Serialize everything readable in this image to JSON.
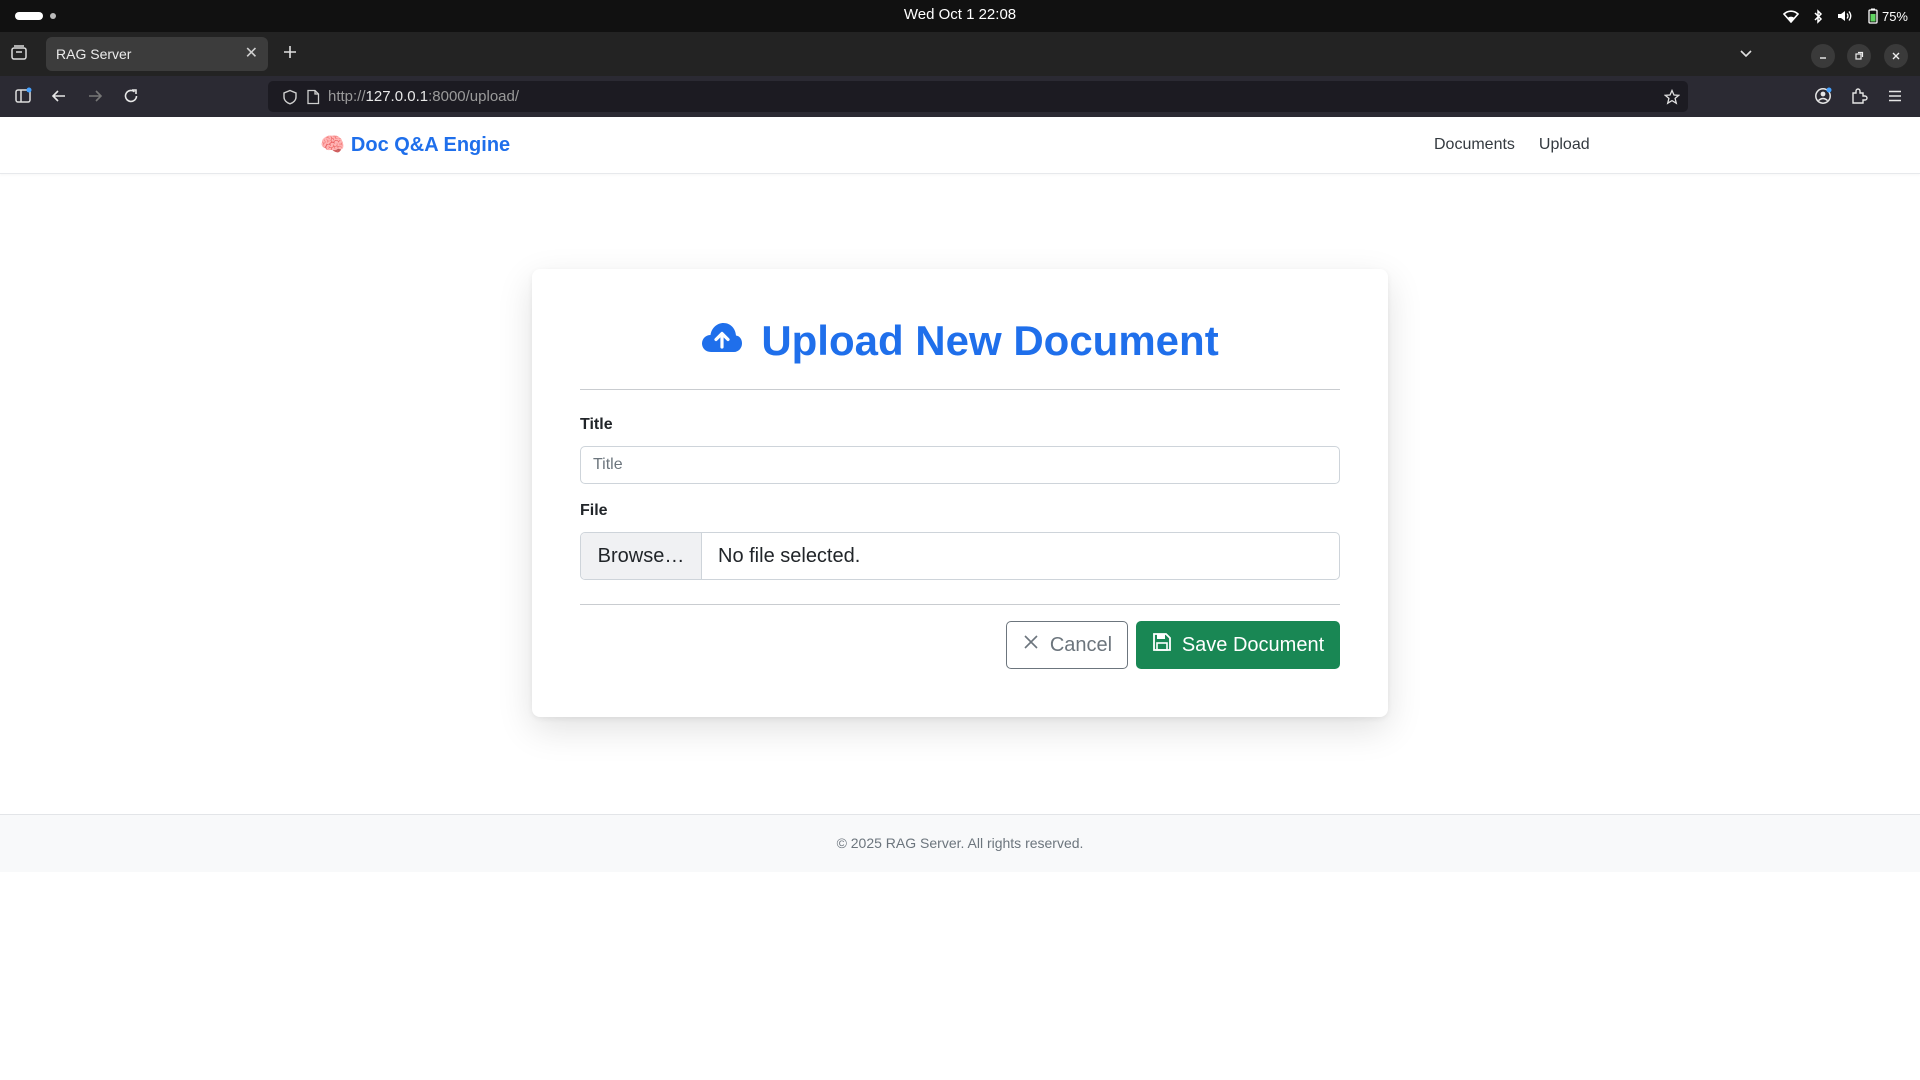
{
  "os": {
    "clock": "Wed Oct 1  22:08",
    "battery": "75%"
  },
  "browser": {
    "tab_title": "RAG Server",
    "url_prefix": "http://",
    "url_host": "127.0.0.1",
    "url_rest": ":8000/upload/"
  },
  "app": {
    "brand_emoji": "🧠",
    "brand": "Doc Q&A Engine",
    "nav": [
      "Documents",
      "Upload"
    ]
  },
  "form": {
    "heading": "Upload New Document",
    "title_label": "Title",
    "title_placeholder": "Title",
    "title_value": "",
    "file_label": "File",
    "browse_label": "Browse…",
    "file_status": "No file selected.",
    "cancel_label": "Cancel",
    "save_label": "Save Document"
  },
  "footer": {
    "text": "© 2025 RAG Server. All rights reserved."
  },
  "colors": {
    "primary": "#1f6feb",
    "success": "#198754",
    "secondary": "#6c757d"
  }
}
